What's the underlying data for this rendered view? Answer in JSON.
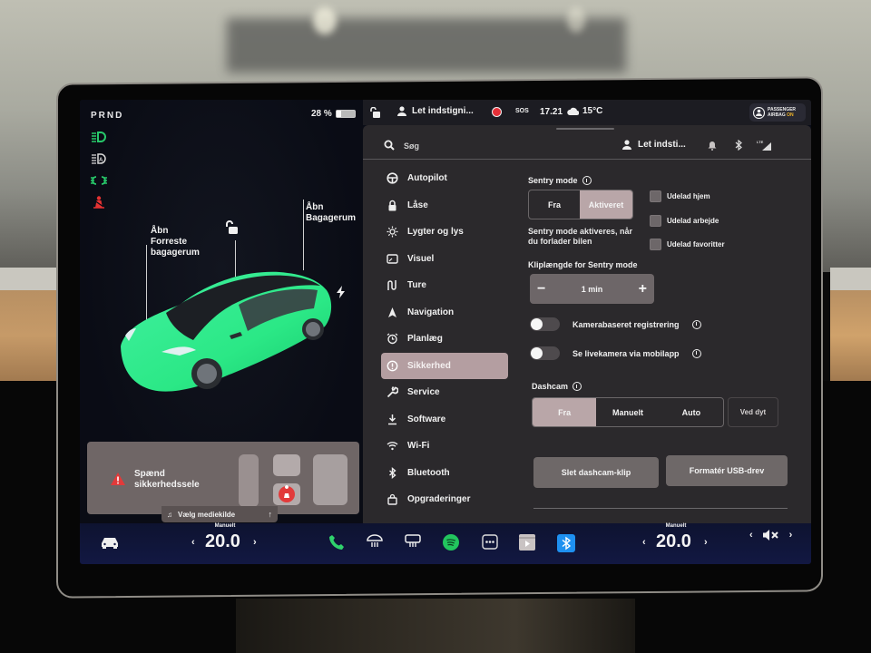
{
  "drive": {
    "gear_selector": "PRND",
    "battery_percent_label": "28 %",
    "battery_level": 0.28
  },
  "telltales": [
    {
      "name": "headlights-icon",
      "color": "#27c86a"
    },
    {
      "name": "auto-headlights-icon",
      "color": "#d9d9d9"
    },
    {
      "name": "parking-lights-icon",
      "color": "#27c86a"
    },
    {
      "name": "seatbelt-warning-icon",
      "color": "#e53232"
    }
  ],
  "car_view": {
    "frunk_label_line1": "Åbn",
    "frunk_label_line2": "Forreste",
    "frunk_label_line3": "bagagerum",
    "trunk_label_line1": "Åbn",
    "trunk_label_line2": "Bagagerum",
    "car_color": "#2ef08a"
  },
  "seatbelt_alert": {
    "line1": "Spænd",
    "line2": "sikkerhedssele"
  },
  "media": {
    "source_label": "Vælg mediekilde"
  },
  "status_bar": {
    "profile_name": "Let indstigni...",
    "sos_label": "SOS",
    "time": "17.21",
    "temperature": "15°C",
    "airbag_line1": "PASSENGER",
    "airbag_line2": "AIRBAG",
    "airbag_state": "ON"
  },
  "settings_header": {
    "search_placeholder": "Søg",
    "profile_name": "Let indsti...",
    "network_label": "LTE"
  },
  "nav": {
    "items": [
      {
        "label": "Autopilot",
        "icon": "steering-wheel-icon"
      },
      {
        "label": "Låse",
        "icon": "lock-icon"
      },
      {
        "label": "Lygter og lys",
        "icon": "light-icon"
      },
      {
        "label": "Visuel",
        "icon": "display-icon"
      },
      {
        "label": "Ture",
        "icon": "trips-icon"
      },
      {
        "label": "Navigation",
        "icon": "navigation-icon"
      },
      {
        "label": "Planlæg",
        "icon": "alarm-clock-icon"
      },
      {
        "label": "Sikkerhed",
        "icon": "info-circle-icon",
        "active": true
      },
      {
        "label": "Service",
        "icon": "wrench-icon"
      },
      {
        "label": "Software",
        "icon": "download-icon"
      },
      {
        "label": "Wi-Fi",
        "icon": "wifi-icon"
      },
      {
        "label": "Bluetooth",
        "icon": "bluetooth-icon"
      },
      {
        "label": "Opgraderinger",
        "icon": "shopping-bag-icon"
      }
    ]
  },
  "security": {
    "sentry_title": "Sentry mode",
    "sentry_options": [
      "Fra",
      "Aktiveret"
    ],
    "sentry_selected": "Aktiveret",
    "sentry_description_line1": "Sentry mode aktiveres, når",
    "sentry_description_line2": "du forlader bilen",
    "exclusions": [
      {
        "label": "Udelad hjem",
        "checked": false
      },
      {
        "label": "Udelad arbejde",
        "checked": false
      },
      {
        "label": "Udelad favoritter",
        "checked": false
      }
    ],
    "clip_length_title": "Kliplængde for Sentry mode",
    "clip_length_value": "1 min",
    "camera_detection_label": "Kamerabaseret registrering",
    "camera_detection_on": false,
    "live_camera_label": "Se livekamera via mobilapp",
    "live_camera_on": false,
    "dashcam_title": "Dashcam",
    "dashcam_options": [
      "Fra",
      "Manuelt",
      "Auto"
    ],
    "dashcam_selected": "Fra",
    "dashcam_on_honk_label": "Ved dyt",
    "delete_clips_label": "Slet dashcam-klip",
    "format_usb_label": "Formatér USB-drev"
  },
  "dock": {
    "driver_temp_mode": "Manuelt",
    "driver_temp": "20.0",
    "passenger_temp_mode": "Manuelt",
    "passenger_temp": "20.0",
    "volume_state": "muted"
  }
}
